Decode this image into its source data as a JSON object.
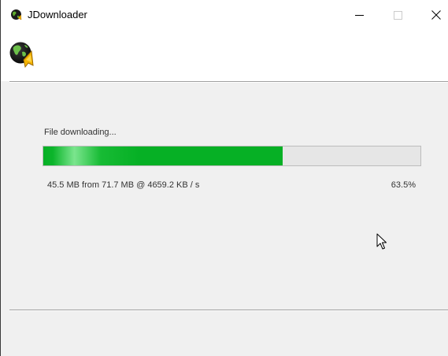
{
  "window": {
    "title": "JDownloader",
    "app_icon": "jdownloader-globe-icon",
    "controls": {
      "minimize_icon": "minimize-icon",
      "maximize_icon": "maximize-icon",
      "close_icon": "close-icon"
    }
  },
  "header": {
    "logo_icon": "jdownloader-logo-icon"
  },
  "download": {
    "status_label": "File downloading...",
    "progress_fraction": 0.635,
    "transfer_info": "45.5 MB from 71.7 MB @ 4659.2 KB / s",
    "percent_text": "63.5%"
  },
  "colors": {
    "progress_green": "#06b025",
    "progress_track": "#e6e6e6",
    "background": "#f0f0f0"
  }
}
